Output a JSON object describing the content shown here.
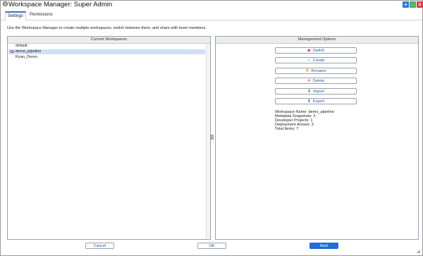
{
  "window": {
    "title": "Workspace Manager: Super Admin",
    "gear_icon": "gear-icon",
    "controls": {
      "add": "+",
      "maximize": "□",
      "close": "×"
    }
  },
  "tabs": [
    {
      "label": "Settings",
      "active": true
    },
    {
      "label": "Permissions",
      "active": false
    }
  ],
  "description": "Use the Workspace Manager to create multiple workspaces, switch between them, and share with team members.",
  "current_workspaces": {
    "header": "Current Workspaces",
    "items": [
      {
        "label": "default",
        "active": false,
        "icon": ""
      },
      {
        "label": "demo_pipeline",
        "active": true,
        "icon": "eye-icon"
      },
      {
        "label": "Ryan_Demo",
        "active": false,
        "icon": ""
      }
    ]
  },
  "management": {
    "header": "Management Options",
    "buttons": [
      {
        "label": "Switch",
        "icon": "eye-icon",
        "glyph": "◉"
      },
      {
        "label": "Create",
        "icon": "check-icon",
        "glyph": "✓"
      },
      {
        "label": "Rename",
        "icon": "rename-icon",
        "glyph": "✥"
      },
      {
        "label": "Delete",
        "icon": "delete-icon",
        "glyph": "✕"
      },
      {
        "label": "Import",
        "icon": "import-icon",
        "glyph": "⬇"
      },
      {
        "label": "Export",
        "icon": "export-icon",
        "glyph": "⬆"
      }
    ],
    "info": [
      "Workspace Name: demo_pipeline",
      "Metadata Snapshots: 3",
      "Developer Projects: 1",
      "Deployment Arrows: 3",
      "Total Items: 7"
    ]
  },
  "footer": {
    "cancel": "Cancel",
    "ok": "OK",
    "next": "Next"
  },
  "colors": {
    "accent": "#1f6ed6",
    "selection": "#cfe0f3"
  }
}
